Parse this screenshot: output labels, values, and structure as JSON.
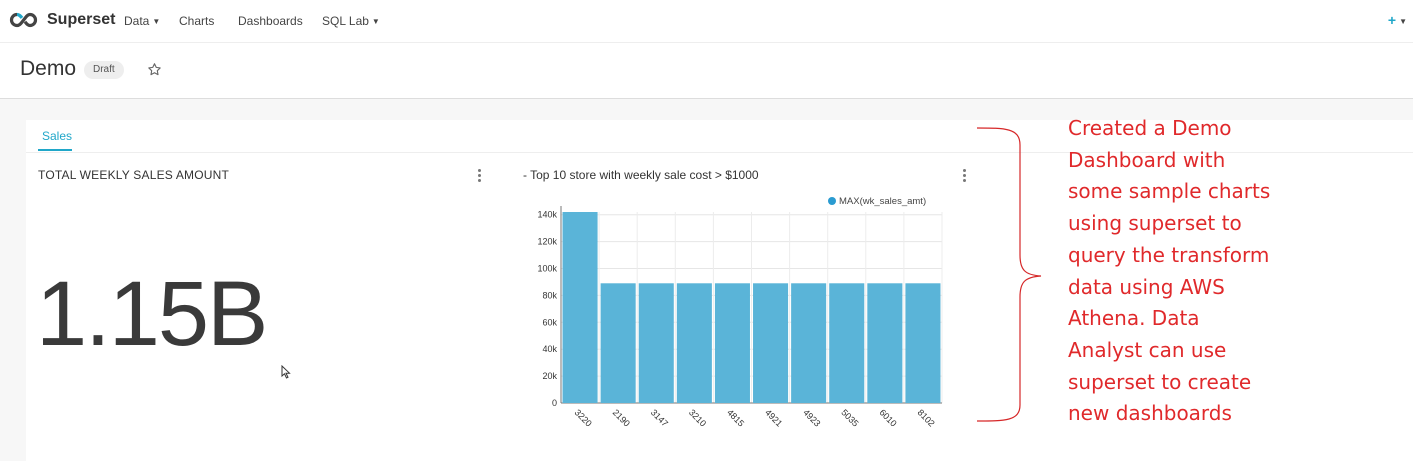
{
  "app": {
    "brand": "Superset",
    "nav": [
      {
        "label": "Data",
        "dropdown": true
      },
      {
        "label": "Charts",
        "dropdown": false
      },
      {
        "label": "Dashboards",
        "dropdown": false
      },
      {
        "label": "SQL Lab",
        "dropdown": true
      }
    ],
    "plus_menu": "+"
  },
  "dashboard": {
    "title": "Demo",
    "badge": "Draft",
    "tabs": [
      {
        "label": "Sales",
        "active": true
      }
    ]
  },
  "charts": {
    "big_number": {
      "title": "TOTAL WEEKLY SALES AMOUNT",
      "value": "1.15B"
    },
    "bar_chart": {
      "title": "- Top 10 store with weekly sale cost > $1000"
    }
  },
  "chart_data": {
    "type": "bar",
    "title": "- Top 10 store with weekly sale cost > $1000",
    "categories": [
      "3220",
      "2190",
      "3147",
      "3210",
      "4815",
      "4921",
      "4923",
      "5035",
      "6010",
      "8102"
    ],
    "series": [
      {
        "name": "MAX(wk_sales_amt)",
        "values": [
          142000,
          89000,
          89000,
          89000,
          89000,
          89000,
          89000,
          89000,
          89000,
          89000
        ]
      }
    ],
    "y_ticks": [
      "0",
      "20k",
      "40k",
      "60k",
      "80k",
      "100k",
      "120k",
      "140k"
    ],
    "ylim": [
      0,
      142000
    ],
    "grid": true,
    "legend_position": "top-right",
    "colors": {
      "bar": "#5ab4d8",
      "legend_dot": "#2a9bd1"
    }
  },
  "annotation": {
    "text": "Created a Demo Dashboard with some sample charts using superset to query the transform data using AWS Athena. Data Analyst can use superset to create new dashboards",
    "lines": [
      "Created a Demo",
      "Dashboard with",
      "some sample charts",
      "using superset to",
      "query the transform",
      "data using AWS",
      "Athena. Data",
      "Analyst can use",
      "superset to create",
      "new dashboards"
    ],
    "color": "#e0292b"
  },
  "colors": {
    "accent": "#20a7c9"
  }
}
